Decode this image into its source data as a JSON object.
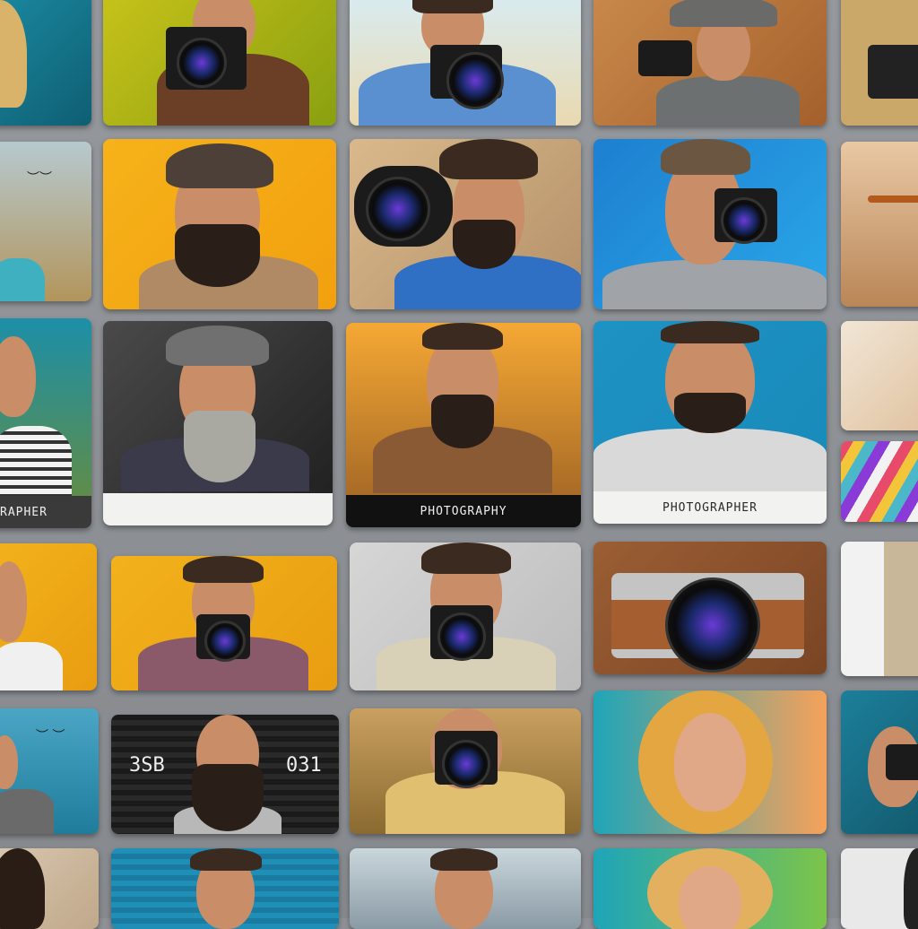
{
  "captions": {
    "left_partial": "RAPHER",
    "photography": "PHOTOGRAPHY",
    "photographer": "PHOTOGRAPHER",
    "bar_left": "3SB",
    "bar_right": "031"
  },
  "colors": {
    "wall": "#8e9196",
    "yellow": "#f2a71c",
    "blue": "#1f8fd6",
    "teal": "#1c7f9a",
    "tan": "#c8a27a"
  }
}
